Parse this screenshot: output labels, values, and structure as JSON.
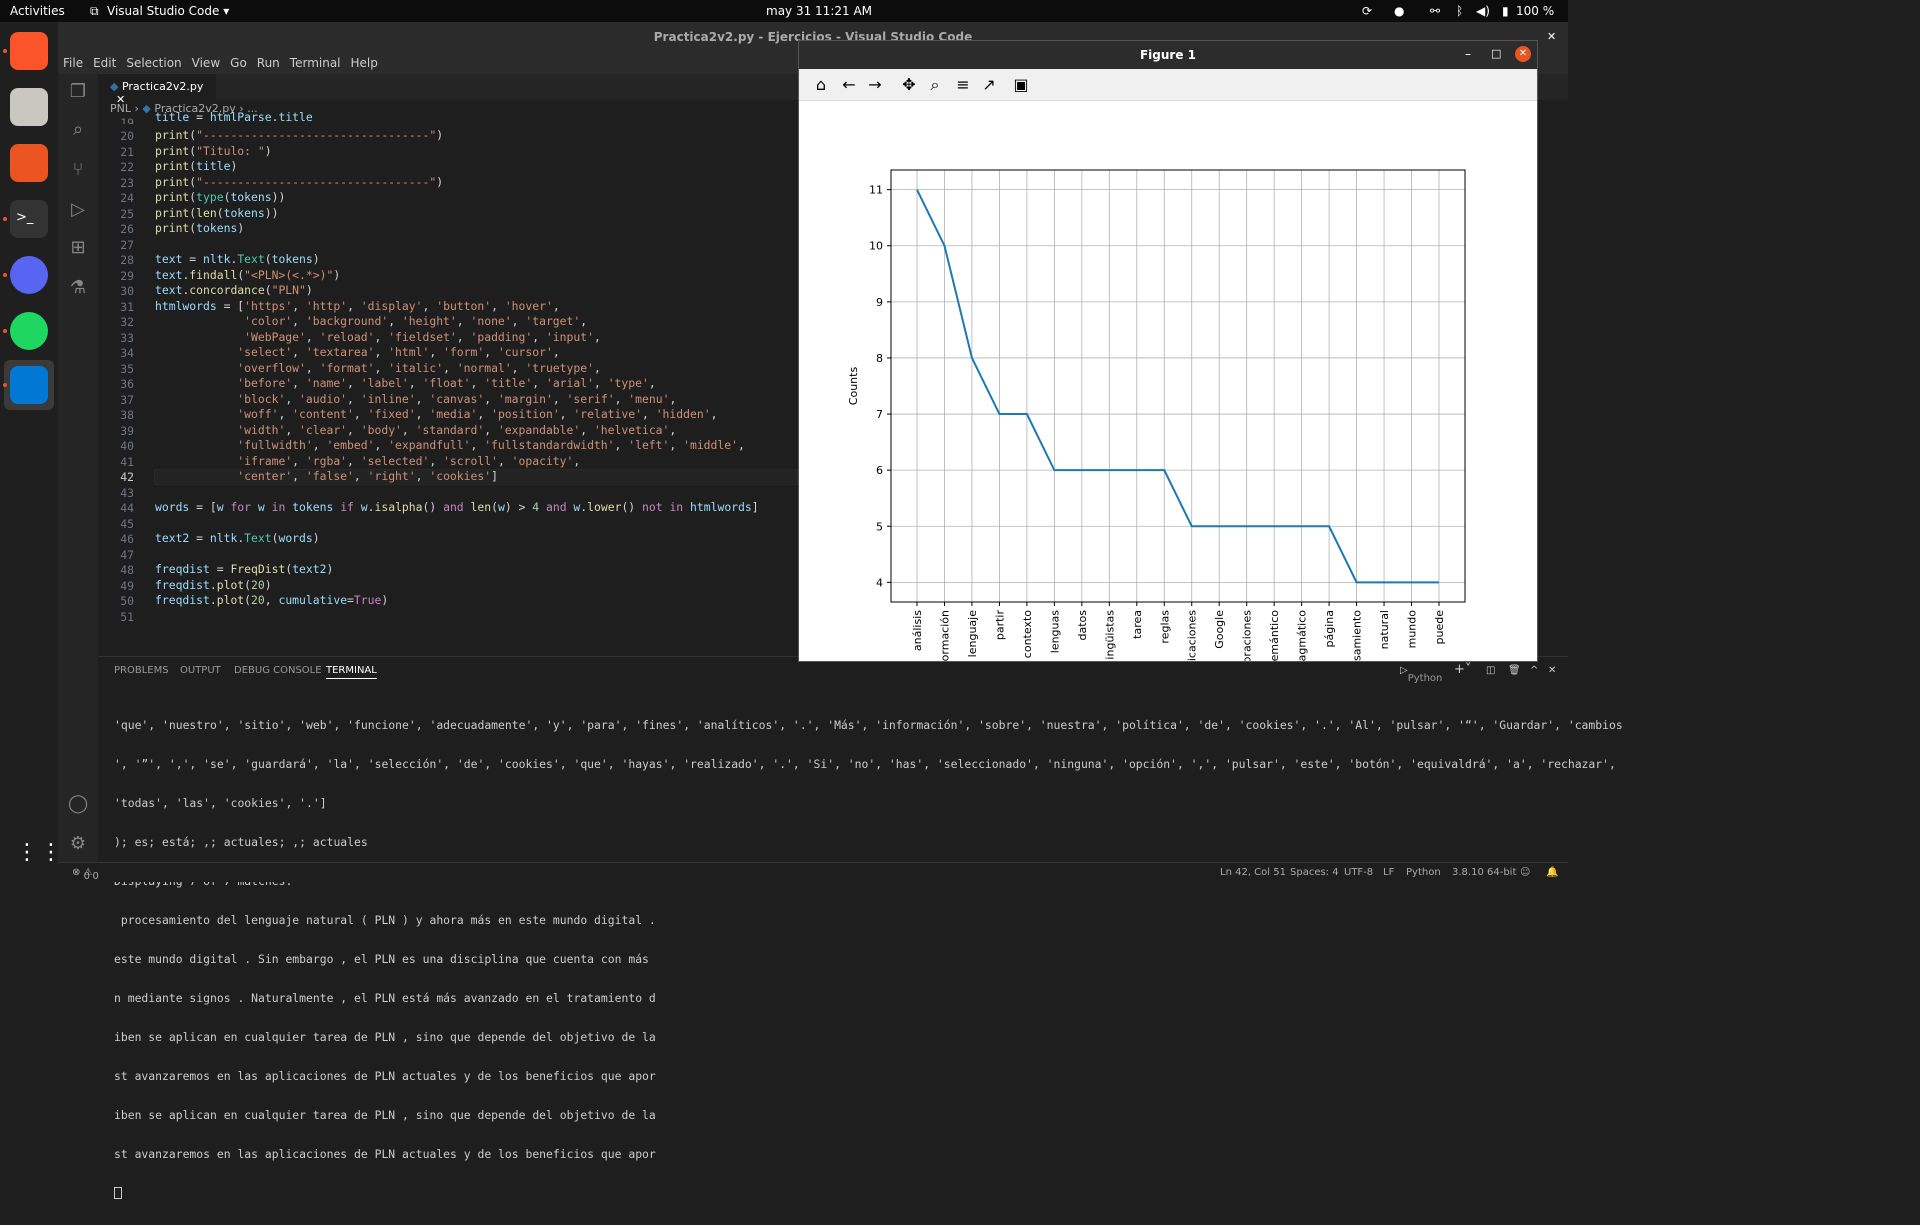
{
  "topbar": {
    "activities": "Activities",
    "app": "Visual Studio Code ▾",
    "datetime": "may 31  11:21 AM",
    "battery": "100 %"
  },
  "window": {
    "title": "Practica2v2.py - Ejercicios - Visual Studio Code"
  },
  "menu": [
    "File",
    "Edit",
    "Selection",
    "View",
    "Go",
    "Run",
    "Terminal",
    "Help"
  ],
  "tab": {
    "name": "Practica2v2.py"
  },
  "breadcrumb": {
    "folder": "PNL",
    "file": "Practica2v2.py",
    "rest": "..."
  },
  "editor": {
    "first_partial": "title = htmlParse.title"
  },
  "panel_tabs": [
    "PROBLEMS",
    "OUTPUT",
    "DEBUG CONSOLE",
    "TERMINAL"
  ],
  "panel_right": {
    "shell": "Python"
  },
  "terminal": [
    "'que', 'nuestro', 'sitio', 'web', 'funcione', 'adecuadamente', 'y', 'para', 'fines', 'analíticos', '.', 'Más', 'información', 'sobre', 'nuestra', 'política', 'de', 'cookies', '.', 'Al', 'pulsar', '“', 'Guardar', 'cambios",
    "', '”', ',', 'se', 'guardará', 'la', 'selección', 'de', 'cookies', 'que', 'hayas', 'realizado', '.', 'Si', 'no', 'has', 'seleccionado', 'ninguna', 'opción', ',', 'pulsar', 'este', 'botón', 'equivaldrá', 'a', 'rechazar',",
    "'todas', 'las', 'cookies', '.']",
    "); es; está; ,; actuales; ,; actuales",
    "Displaying 7 of 7 matches:",
    " procesamiento del lenguaje natural ( PLN ) y ahora más en este mundo digital .",
    "este mundo digital . Sin embargo , el PLN es una disciplina que cuenta con más",
    "n mediante signos . Naturalmente , el PLN está más avanzado en el tratamiento d",
    "iben se aplican en cualquier tarea de PLN , sino que depende del objetivo de la",
    "st avanzaremos en las aplicaciones de PLN actuales y de los beneficios que apor",
    "iben se aplican en cualquier tarea de PLN , sino que depende del objetivo de la",
    "st avanzaremos en las aplicaciones de PLN actuales y de los beneficios que apor"
  ],
  "status": {
    "errors": "0",
    "warnings": "0",
    "position": "Ln 42, Col 51",
    "spaces": "Spaces: 4",
    "encoding": "UTF-8",
    "eol": "LF",
    "language": "Python",
    "interpreter": "3.8.10 64-bit"
  },
  "figure": {
    "title": "Figure 1"
  },
  "chart_data": {
    "type": "line",
    "ylabel": "Counts",
    "xlabel": "",
    "categories": [
      "análisis",
      "ormación",
      "lenguaje",
      "partir",
      "contexto",
      "lenguas",
      "datos",
      "ingüistas",
      "tarea",
      "reglas",
      "icaciones",
      "Google",
      "oraciones",
      "emántico",
      "agmático",
      "página",
      "samiento",
      "natural",
      "mundo",
      "puede"
    ],
    "values": [
      11,
      10,
      8,
      7,
      7,
      6,
      6,
      6,
      6,
      6,
      5,
      5,
      5,
      5,
      5,
      5,
      4,
      4,
      4,
      4
    ],
    "ylim": [
      3.65,
      11.35
    ],
    "yticks": [
      4,
      5,
      6,
      7,
      8,
      9,
      10,
      11
    ],
    "grid": true,
    "color": "#1f77b4"
  }
}
